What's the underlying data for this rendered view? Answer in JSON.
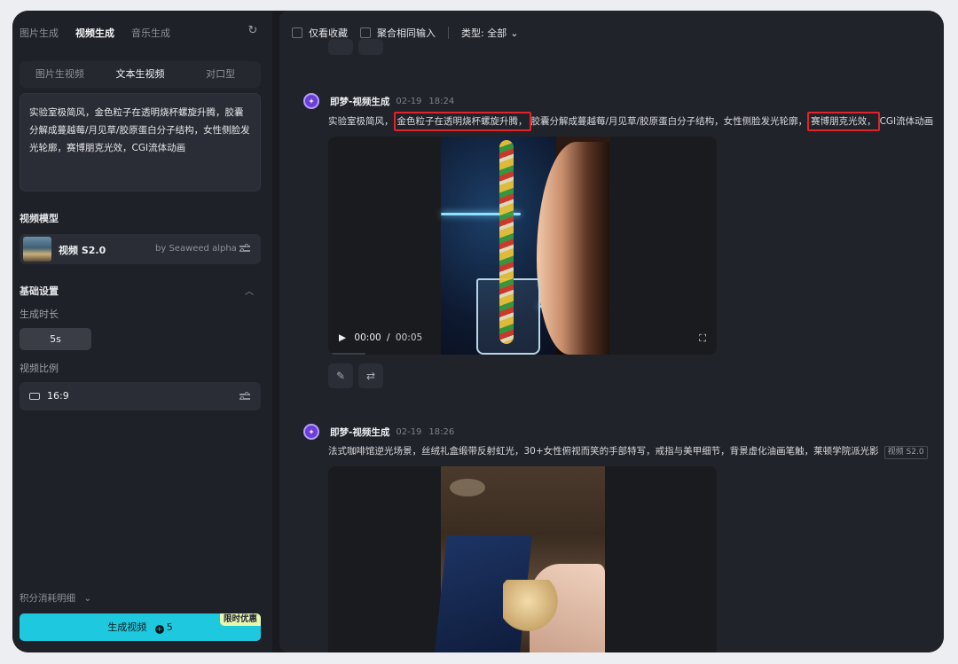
{
  "sidebar": {
    "top_tabs": [
      "图片生成",
      "视频生成",
      "音乐生成"
    ],
    "active_top_tab": "视频生成",
    "sub_tabs": [
      "图片生视频",
      "文本生视频",
      "对口型"
    ],
    "active_sub_tab": "文本生视频",
    "prompt": "实验室极简风，金色粒子在透明烧杯螺旋升腾，胶囊分解成蔓越莓/月见草/胶原蛋白分子结构，女性侧脸发光轮廓，赛博朋克光效，CGI流体动画",
    "model_section_label": "视频模型",
    "model_name": "视频 S2.0",
    "model_by": "by Seaweed alpha",
    "basic_settings_label": "基础设置",
    "duration_label": "生成时长",
    "duration_value": "5s",
    "ratio_label": "视频比例",
    "ratio_value": "16:9",
    "points_label": "积分消耗明细",
    "generate_label": "生成视频",
    "generate_cost": "5",
    "promo_badge": "限时优惠"
  },
  "main": {
    "filters": {
      "favorites_label": "仅看收藏",
      "merge_label": "聚合相同输入",
      "type_label": "类型: 全部"
    },
    "generations": [
      {
        "title": "即梦-视频生成",
        "date": "02-19",
        "time": "18:24",
        "prompt_part1": "实验室极简风，",
        "prompt_highlight1": "金色粒子在透明烧杯螺旋升腾，",
        "prompt_part2": "胶囊分解成蔓越莓/月见草/胶原蛋白分子结构，女性侧脸发光轮廓，",
        "prompt_highlight2": "赛博朋克光效，",
        "prompt_part3": "CGI流体动画",
        "current_time": "00:00",
        "duration": "00:05"
      },
      {
        "title": "即梦-视频生成",
        "date": "02-19",
        "time": "18:26",
        "prompt": "法式咖啡馆逆光场景，丝绒礼盒缎带反射虹光，30+女性俯视而笑的手部特写，戒指与美甲细节，背景虚化油画笔触，莱顿学院派光影",
        "model_tag": "视频 S2.0"
      }
    ]
  },
  "icons": {
    "refresh": "refresh-icon",
    "settings": "sliders-icon",
    "play": "play-icon",
    "fullscreen": "fullscreen-icon",
    "edit": "pencil-icon",
    "regenerate": "repeat-icon"
  },
  "colors": {
    "accent": "#1ec9e0",
    "highlight_box": "#e0242a",
    "avatar": "#6b3fd6"
  }
}
